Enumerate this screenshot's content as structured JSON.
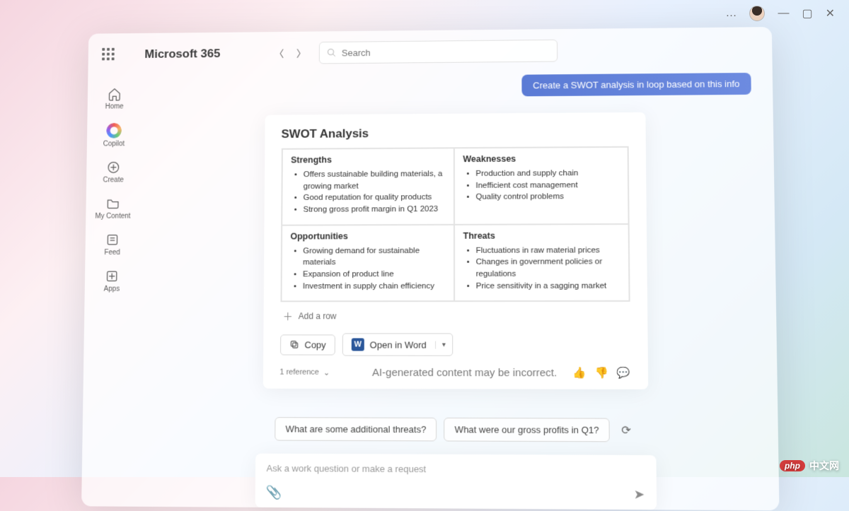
{
  "titlebar": {
    "more": "…",
    "minimize": "—",
    "maximize": "▢",
    "close": "✕"
  },
  "brand": "Microsoft 365",
  "search": {
    "placeholder": "Search"
  },
  "sidebar": {
    "items": [
      {
        "label": "Home"
      },
      {
        "label": "Copilot"
      },
      {
        "label": "Create"
      },
      {
        "label": "My Content"
      },
      {
        "label": "Feed"
      },
      {
        "label": "Apps"
      }
    ]
  },
  "chat": {
    "user_message": "Create a SWOT analysis in loop based on this info",
    "response": {
      "title": "SWOT Analysis",
      "quadrants": [
        {
          "heading": "Strengths",
          "items": [
            "Offers sustainable building materials, a growing market",
            "Good reputation for quality products",
            "Strong gross profit margin in Q1 2023"
          ]
        },
        {
          "heading": "Weaknesses",
          "items": [
            "Production and supply chain",
            "Inefficient cost management",
            "Quality control problems"
          ]
        },
        {
          "heading": "Opportunities",
          "items": [
            "Growing demand for sustainable materials",
            "Expansion of product line",
            "Investment in supply chain efficiency"
          ]
        },
        {
          "heading": "Threats",
          "items": [
            "Fluctuations in raw material prices",
            "Changes in government policies or regulations",
            "Price sensitivity in a sagging market"
          ]
        }
      ],
      "add_row_label": "Add a row",
      "actions": {
        "copy": "Copy",
        "open_word": "Open in Word"
      },
      "ai_note": "AI-generated content may be incorrect.",
      "reference_label": "1 reference"
    },
    "suggestions": [
      "What are some additional threats?",
      "What were our gross profits in Q1?"
    ],
    "composer_placeholder": "Ask a work question or make a request"
  },
  "watermark": {
    "tag": "php",
    "text": "中文网"
  }
}
